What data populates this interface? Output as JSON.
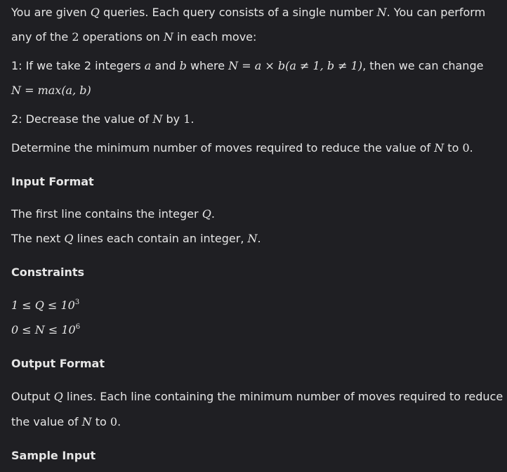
{
  "problem": {
    "statement": {
      "line1": {
        "t1": "You are given ",
        "q": "Q",
        "t2": " queries. Each query consists of a single number ",
        "n": "N",
        "t3": ". You can perform"
      },
      "line2": {
        "t1": "any of the ",
        "two": "2",
        "t2": " operations on ",
        "n": "N",
        "t3": " in each move:"
      },
      "op1_line1": {
        "t1": "1: If we take 2 integers ",
        "a": "a",
        "t2": " and ",
        "b": "b",
        "t3": " where ",
        "expr": "N = a × b(a ≠ 1, b ≠ 1)",
        "t4": ", then we can change"
      },
      "op1_line2": {
        "expr": "N = max(a, b)"
      },
      "op2": {
        "t1": "2: Decrease the value of ",
        "n": "N",
        "t2": " by ",
        "one": "1",
        "t3": "."
      },
      "goal": {
        "t1": "Determine the minimum number of moves required to reduce the value of ",
        "n": "N",
        "t2": " to ",
        "zero": "0",
        "t3": "."
      }
    },
    "input_format": {
      "heading": "Input Format",
      "line1": {
        "t1": "The first line contains the integer ",
        "q": "Q",
        "t2": "."
      },
      "line2": {
        "t1": "The next ",
        "q": "Q",
        "t2": " lines each contain an integer, ",
        "n": "N",
        "t3": "."
      }
    },
    "constraints": {
      "heading": "Constraints",
      "c1": {
        "expr": "1 ≤ Q ≤ 10",
        "exp": "3"
      },
      "c2": {
        "expr": "0 ≤ N ≤ 10",
        "exp": "6"
      }
    },
    "output_format": {
      "heading": "Output Format",
      "line1": {
        "t1": "Output ",
        "q": "Q",
        "t2": " lines. Each line containing the minimum number of moves required to reduce"
      },
      "line2": {
        "t1": "the value of ",
        "n": "N",
        "t2": " to ",
        "zero": "0",
        "t3": "."
      }
    },
    "sample_input": {
      "heading": "Sample Input"
    }
  }
}
